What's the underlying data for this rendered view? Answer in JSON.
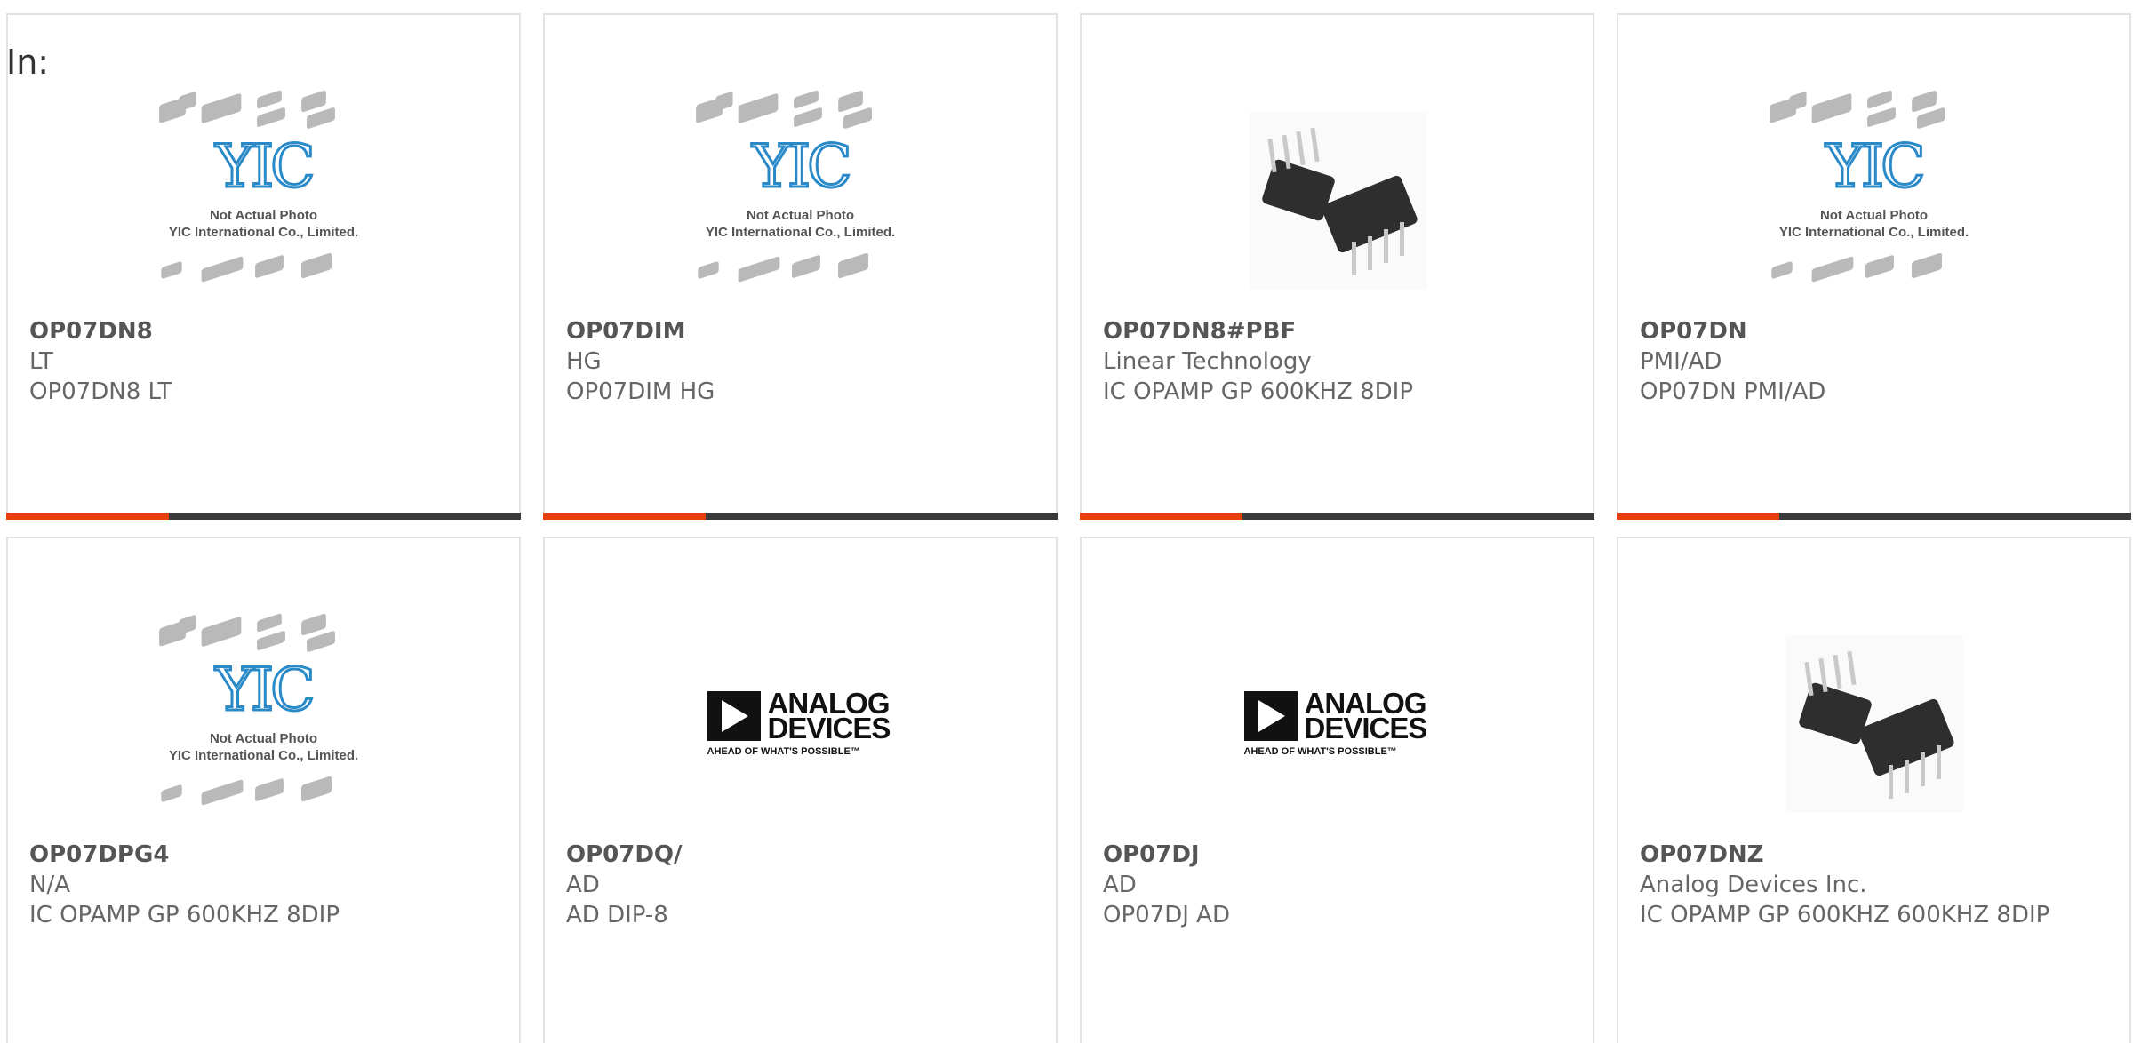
{
  "page": {
    "label": "In:"
  },
  "placeholder_caption": {
    "line1": "Not Actual Photo",
    "line2": "YIC International Co., Limited."
  },
  "logo_text": {
    "yic": "YIC",
    "analog_line1": "ANALOG",
    "analog_line2": "DEVICES",
    "analog_tagline": "AHEAD OF WHAT'S POSSIBLE™"
  },
  "colors": {
    "accent": "#e8400c",
    "bar": "#3a3a3a",
    "yic_blue": "#2a8ac8"
  },
  "products": [
    {
      "part": "OP07DN8",
      "manufacturer": "LT",
      "description": "OP07DN8 LT",
      "image": "yic-placeholder"
    },
    {
      "part": "OP07DIM",
      "manufacturer": "HG",
      "description": "OP07DIM HG",
      "image": "yic-placeholder"
    },
    {
      "part": "OP07DN8#PBF",
      "manufacturer": "Linear Technology",
      "description": "IC OPAMP GP 600KHZ 8DIP",
      "image": "dip-photo"
    },
    {
      "part": "OP07DN",
      "manufacturer": "PMI/AD",
      "description": "OP07DN PMI/AD",
      "image": "yic-placeholder"
    },
    {
      "part": "OP07DPG4",
      "manufacturer": "N/A",
      "description": "IC OPAMP GP 600KHZ 8DIP",
      "image": "yic-placeholder"
    },
    {
      "part": "OP07DQ/",
      "manufacturer": "AD",
      "description": "AD DIP-8",
      "image": "analog-devices-logo"
    },
    {
      "part": "OP07DJ",
      "manufacturer": "AD",
      "description": "OP07DJ AD",
      "image": "analog-devices-logo"
    },
    {
      "part": "OP07DNZ",
      "manufacturer": "Analog Devices Inc.",
      "description": "IC OPAMP GP 600KHZ 600KHZ 8DIP",
      "image": "dip-photo"
    }
  ]
}
